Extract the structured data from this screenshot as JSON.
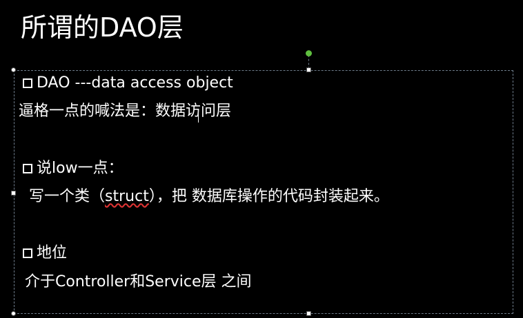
{
  "slide": {
    "title": "所谓的DAO层",
    "items": [
      {
        "bullet": true,
        "text": "DAO ---data access object"
      },
      {
        "bullet": false,
        "text": "逼格一点的喊法是：数据访问层"
      },
      {
        "bullet": true,
        "text": "说low一点："
      },
      {
        "bullet": false,
        "pre": "写一个类（",
        "mark": "struct",
        "post": "），把 数据库操作的代码封装起来。"
      },
      {
        "bullet": true,
        "text": "地位"
      },
      {
        "bullet": false,
        "text": "介于Controller和Service层 之间"
      }
    ]
  }
}
